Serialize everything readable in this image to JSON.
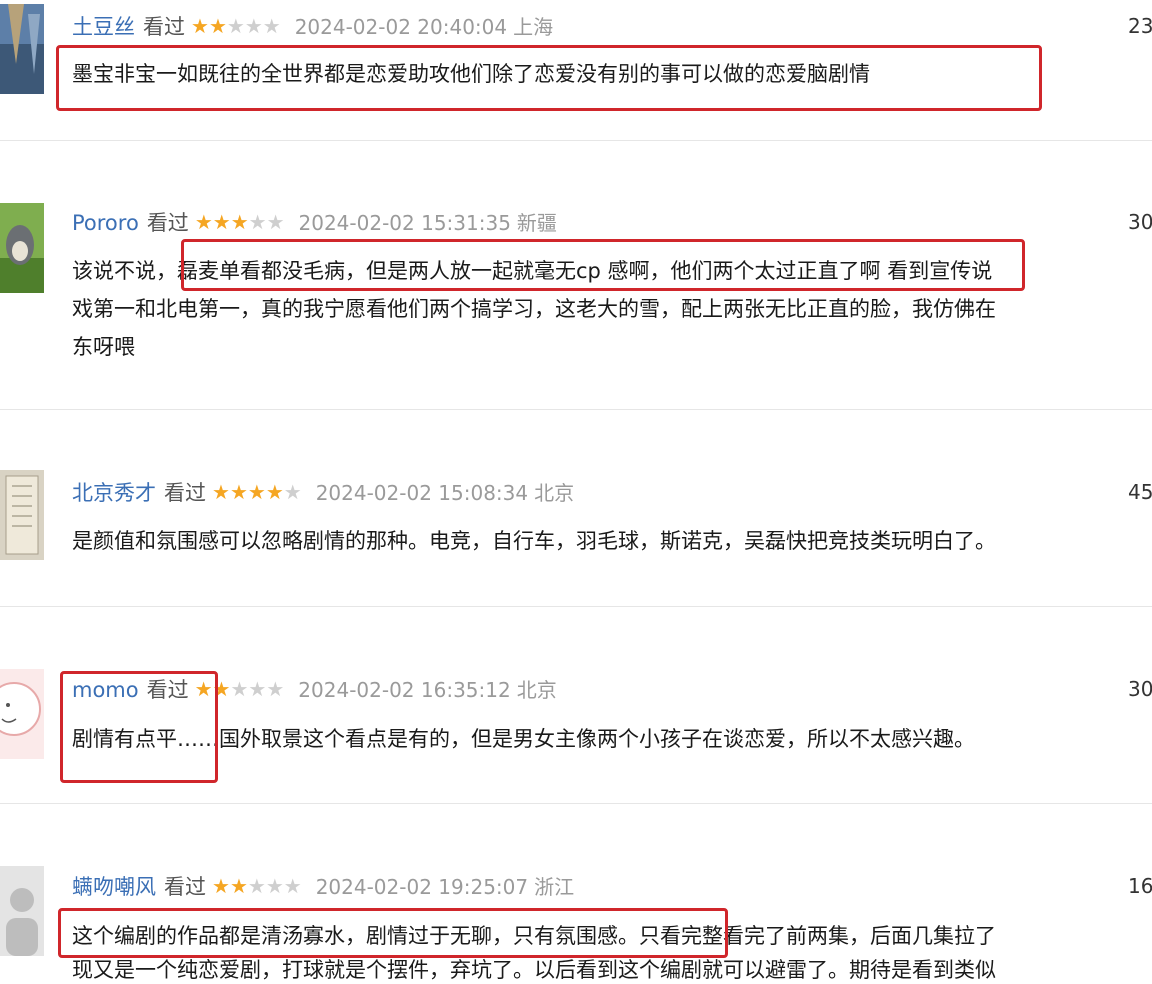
{
  "reviews": [
    {
      "user": "土豆丝",
      "status": "看过",
      "rating": 2,
      "time": "2024-02-02 20:40:04",
      "location": "上海",
      "votes": "23",
      "lines": [
        "墨宝非宝一如既往的全世界都是恋爱助攻他们除了恋爱没有别的事可以做的恋爱脑剧情"
      ]
    },
    {
      "user": "Pororo",
      "status": "看过",
      "rating": 3,
      "time": "2024-02-02 15:31:35",
      "location": "新疆",
      "votes": "30",
      "lines": [
        "该说不说，磊麦单看都没毛病，但是两人放一起就毫无cp 感啊，他们两个太过正直了啊  看到宣传说",
        "戏第一和北电第一，真的我宁愿看他们两个搞学习，这老大的雪，配上两张无比正直的脸，我仿佛在",
        "东呀喂"
      ]
    },
    {
      "user": "北京秀才",
      "status": "看过",
      "rating": 4,
      "time": "2024-02-02 15:08:34",
      "location": "北京",
      "votes": "45",
      "lines": [
        "是颜值和氛围感可以忽略剧情的那种。电竞，自行车，羽毛球，斯诺克，吴磊快把竞技类玩明白了。"
      ]
    },
    {
      "user": "momo",
      "status": "看过",
      "rating": 2,
      "time": "2024-02-02 16:35:12",
      "location": "北京",
      "votes": "30",
      "lines": [
        "剧情有点平……国外取景这个看点是有的，但是男女主像两个小孩子在谈恋爱，所以不太感兴趣。"
      ]
    },
    {
      "user": "螨吻嘲风",
      "status": "看过",
      "rating": 2,
      "time": "2024-02-02 19:25:07",
      "location": "浙江",
      "votes": "16",
      "lines": [
        "这个编剧的作品都是清汤寡水，剧情过于无聊，只有氛围感。只看完整看完了前两集，后面几集拉了",
        "现又是一个纯恋爱剧，打球就是个摆件，弃坑了。以后看到这个编剧就可以避雷了。期待是看到类似"
      ]
    }
  ]
}
